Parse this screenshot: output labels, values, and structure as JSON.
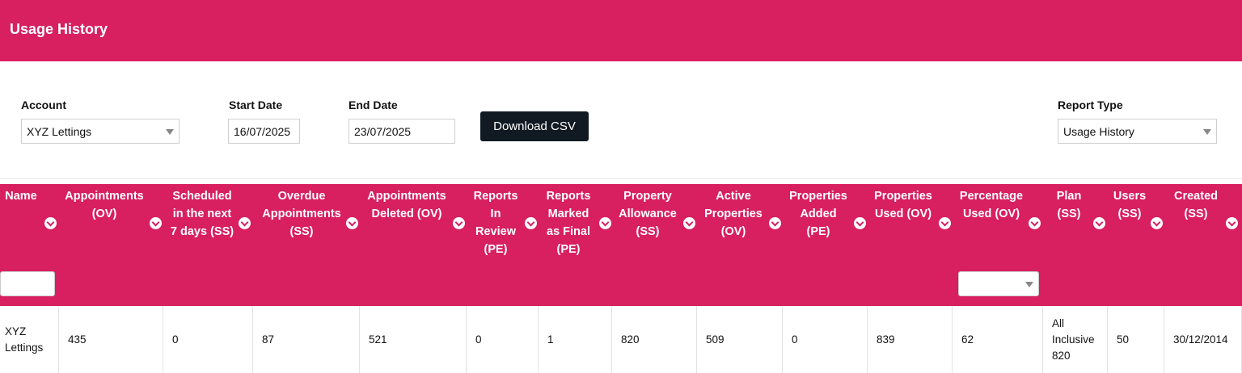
{
  "header": {
    "title": "Usage History"
  },
  "filters": {
    "account_label": "Account",
    "account_value": "XYZ Lettings",
    "start_label": "Start Date",
    "start_value": "16/07/2025",
    "end_label": "End Date",
    "end_value": "23/07/2025",
    "download_label": "Download CSV",
    "report_type_label": "Report Type",
    "report_type_value": "Usage History"
  },
  "columns": [
    "Name",
    "Appointments (OV)",
    "Scheduled in the next 7 days (SS)",
    "Overdue Appointments (SS)",
    "Appointments Deleted (OV)",
    "Reports In Review (PE)",
    "Reports Marked as Final (PE)",
    "Property Allowance (SS)",
    "Active Properties (OV)",
    "Properties Added (PE)",
    "Properties Used (OV)",
    "Percentage Used (OV)",
    "Plan (SS)",
    "Users (SS)",
    "Created (SS)"
  ],
  "header_lines": [
    [
      "Name"
    ],
    [
      "Appointments",
      "(OV)"
    ],
    [
      "Scheduled",
      "in the next",
      "7 days (SS)"
    ],
    [
      "Overdue",
      "Appointments",
      "(SS)"
    ],
    [
      "Appointments",
      "Deleted (OV)"
    ],
    [
      "Reports",
      "In",
      "Review",
      "(PE)"
    ],
    [
      "Reports",
      "Marked",
      "as Final",
      "(PE)"
    ],
    [
      "Property",
      "Allowance",
      "(SS)"
    ],
    [
      "Active",
      "Properties",
      "(OV)"
    ],
    [
      "Properties",
      "Added",
      "(PE)"
    ],
    [
      "Properties",
      "Used (OV)"
    ],
    [
      "Percentage",
      "Used (OV)"
    ],
    [
      "Plan",
      "(SS)"
    ],
    [
      "Users",
      "(SS)"
    ],
    [
      "Created",
      "(SS)"
    ]
  ],
  "rows": [
    {
      "name": "XYZ Lettings",
      "cells": [
        "XYZ Lettings",
        "435",
        "0",
        "87",
        "521",
        "0",
        "1",
        "820",
        "509",
        "0",
        "839",
        "62",
        "All Inclusive 820",
        "50",
        "30/12/2014"
      ],
      "cell_lines": [
        [
          "XYZ",
          "Lettings"
        ],
        [
          "435"
        ],
        [
          "0"
        ],
        [
          "87"
        ],
        [
          "521"
        ],
        [
          "0"
        ],
        [
          "1"
        ],
        [
          "820"
        ],
        [
          "509"
        ],
        [
          "0"
        ],
        [
          "839"
        ],
        [
          "62"
        ],
        [
          "All",
          "Inclusive",
          "820"
        ],
        [
          "50"
        ],
        [
          "30/12/2014"
        ]
      ]
    }
  ],
  "colors": {
    "brand": "#d81f5f",
    "button": "#111a23"
  }
}
